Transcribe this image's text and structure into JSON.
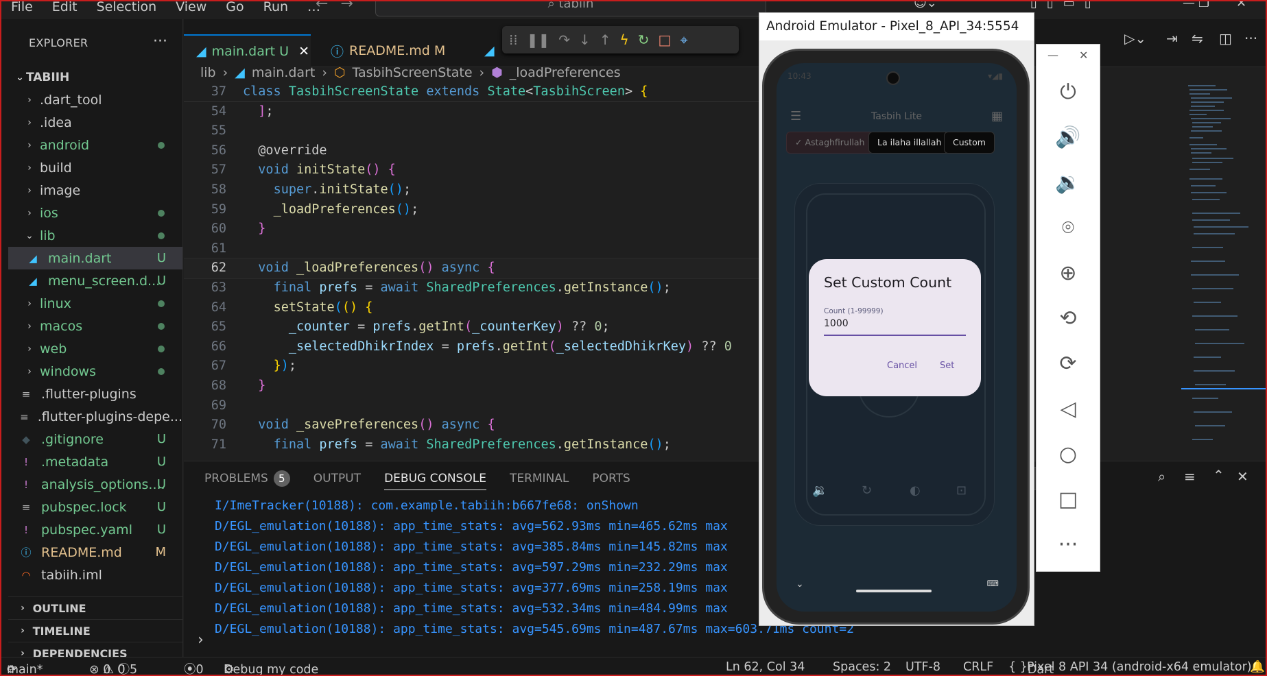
{
  "menu": [
    "File",
    "Edit",
    "Selection",
    "View",
    "Go",
    "Run",
    "…"
  ],
  "search": "tabiih",
  "explorer": {
    "title": "EXPLORER",
    "project": "TABIIH",
    "items": [
      {
        "name": ".dart_tool",
        "type": "folder",
        "color": "",
        "badge": ""
      },
      {
        "name": ".idea",
        "type": "folder",
        "color": "",
        "badge": ""
      },
      {
        "name": "android",
        "type": "folder",
        "color": "green",
        "badge": "dot"
      },
      {
        "name": "build",
        "type": "folder",
        "color": "",
        "badge": ""
      },
      {
        "name": "image",
        "type": "folder",
        "color": "",
        "badge": ""
      },
      {
        "name": "ios",
        "type": "folder",
        "color": "green",
        "badge": "dot"
      },
      {
        "name": "lib",
        "type": "open",
        "color": "green",
        "badge": "dot"
      },
      {
        "name": "main.dart",
        "type": "dart",
        "color": "green",
        "badge": "U"
      },
      {
        "name": "menu_screen.d...",
        "type": "dart",
        "color": "green",
        "badge": "U"
      },
      {
        "name": "linux",
        "type": "folder",
        "color": "green",
        "badge": "dot"
      },
      {
        "name": "macos",
        "type": "folder",
        "color": "green",
        "badge": "dot"
      },
      {
        "name": "web",
        "type": "folder",
        "color": "green",
        "badge": "dot"
      },
      {
        "name": "windows",
        "type": "folder",
        "color": "green",
        "badge": "dot"
      },
      {
        "name": ".flutter-plugins",
        "type": "file",
        "color": "",
        "badge": ""
      },
      {
        "name": ".flutter-plugins-depe...",
        "type": "file",
        "color": "",
        "badge": ""
      },
      {
        "name": ".gitignore",
        "type": "git",
        "color": "green",
        "badge": "U"
      },
      {
        "name": ".metadata",
        "type": "excl",
        "color": "green",
        "badge": "U"
      },
      {
        "name": "analysis_options....",
        "type": "excl",
        "color": "green",
        "badge": "U"
      },
      {
        "name": "pubspec.lock",
        "type": "file",
        "color": "green",
        "badge": "U"
      },
      {
        "name": "pubspec.yaml",
        "type": "excl",
        "color": "green",
        "badge": "U"
      },
      {
        "name": "README.md",
        "type": "info",
        "color": "yellow",
        "badge": "M"
      },
      {
        "name": "tabiih.iml",
        "type": "rss",
        "color": "",
        "badge": ""
      }
    ],
    "footer": [
      "OUTLINE",
      "TIMELINE",
      "DEPENDENCIES"
    ]
  },
  "tabs": [
    {
      "label": "main.dart",
      "status": "U"
    },
    {
      "label": "README.md",
      "status": "M"
    }
  ],
  "breadcrumb": [
    "lib",
    "main.dart",
    "TasbihScreenState",
    "_loadPreferences"
  ],
  "panel": {
    "tabs": [
      "PROBLEMS",
      "OUTPUT",
      "DEBUG CONSOLE",
      "TERMINAL",
      "PORTS"
    ],
    "problems_count": "5",
    "lines": [
      "I/ImeTracker(10188): com.example.tabiih:b667fe68: onShown",
      "D/EGL_emulation(10188): app_time_stats: avg=562.93ms min=465.62ms max",
      "D/EGL_emulation(10188): app_time_stats: avg=385.84ms min=145.82ms max",
      "D/EGL_emulation(10188): app_time_stats: avg=597.29ms min=232.29ms max",
      "D/EGL_emulation(10188): app_time_stats: avg=377.69ms min=258.19ms max",
      "D/EGL_emulation(10188): app_time_stats: avg=532.34ms min=484.99ms max",
      "D/EGL_emulation(10188): app_time_stats: avg=545.69ms min=487.67ms max=603.71ms count=2"
    ]
  },
  "status": {
    "branch": "main*",
    "errors": "0",
    "warnings": "0",
    "info": "5",
    "ports": "0",
    "debug": "Debug my code",
    "position": "Ln 62, Col 34",
    "spaces": "Spaces: 2",
    "encoding": "UTF-8",
    "eol": "CRLF",
    "lang": "Dart",
    "device": "Pixel 8 API 34 (android-x64 emulator)"
  },
  "emulator": {
    "title": "Android Emulator - Pixel_8_API_34:5554",
    "time": "10:43",
    "app_title": "Tasbih Lite",
    "chips": [
      "Astaghfirullah",
      "La ilaha illallah",
      "Custom"
    ],
    "dialog": {
      "title": "Set Custom Count",
      "label": "Count (1-99999)",
      "value": "1000",
      "cancel": "Cancel",
      "set": "Set"
    }
  }
}
